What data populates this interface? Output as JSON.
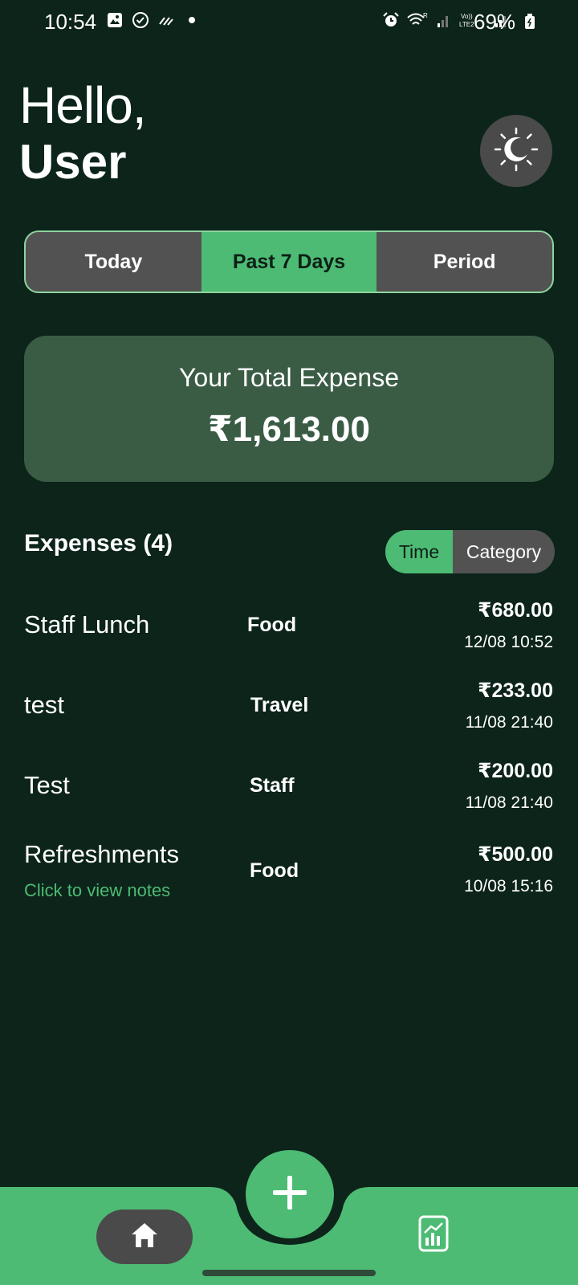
{
  "status_bar": {
    "time": "10:54",
    "battery": "69%",
    "left_icons": [
      "gallery-icon",
      "check-circle-icon",
      "signal-app-icon",
      "dot-icon"
    ],
    "right_icons": [
      "alarm-icon",
      "wifi-icon",
      "signal-icon",
      "volte-lte2-icon",
      "signal-icon",
      "battery-icon"
    ]
  },
  "header": {
    "greeting": "Hello,",
    "user": "User",
    "theme_toggle_icon": "sun-moon-icon"
  },
  "period_tabs": {
    "items": [
      "Today",
      "Past 7 Days",
      "Period"
    ],
    "active": "Past 7 Days"
  },
  "total": {
    "label": "Your Total Expense",
    "amount": "₹1,613.00"
  },
  "expenses": {
    "title": "Expenses (4)",
    "sort_options": [
      "Time",
      "Category"
    ],
    "active_sort": "Time",
    "items": [
      {
        "name": "Staff Lunch",
        "category": "Food",
        "amount": "₹680.00",
        "date": "12/08 10:52",
        "note": ""
      },
      {
        "name": "test",
        "category": "Travel",
        "amount": "₹233.00",
        "date": "11/08 21:40",
        "note": ""
      },
      {
        "name": "Test",
        "category": "Staff",
        "amount": "₹200.00",
        "date": "11/08 21:40",
        "note": ""
      },
      {
        "name": "Refreshments",
        "category": "Food",
        "amount": "₹500.00",
        "date": "10/08 15:16",
        "note": "Click to view notes"
      }
    ]
  },
  "nav": {
    "home_icon": "home-icon",
    "add_icon": "plus-icon",
    "stats_icon": "chart-icon"
  },
  "colors": {
    "background": "#0c241a",
    "accent": "#4dbb74",
    "card": "#3a5c45",
    "segment": "#525252"
  }
}
